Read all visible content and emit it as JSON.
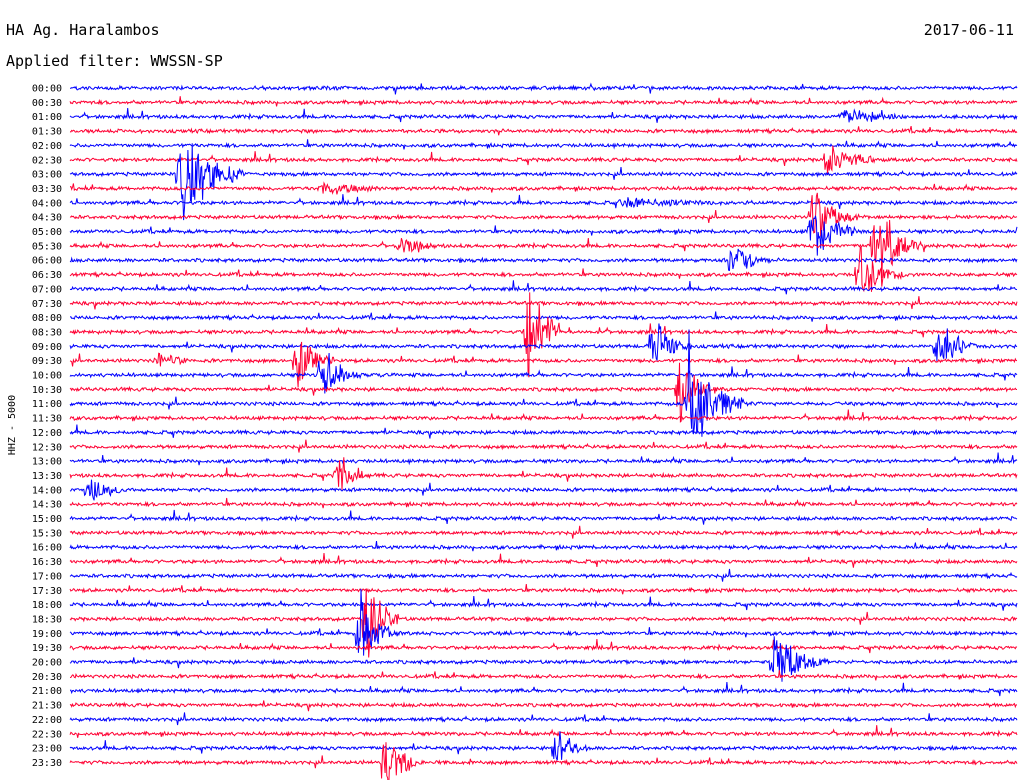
{
  "header": {
    "station": "HA Ag. Haralambos",
    "filter": "Applied filter: WWSSN-SP",
    "date": "2017-06-11"
  },
  "chart_data": {
    "type": "line",
    "title": "HA Ag. Haralambos",
    "ylabel": "HHZ - 5000",
    "row_interval_minutes": 30,
    "colors": {
      "blue": "#0000ff",
      "red": "#ff0033"
    },
    "rows": [
      "00:00",
      "00:30",
      "01:00",
      "01:30",
      "02:00",
      "02:30",
      "03:00",
      "03:30",
      "04:00",
      "04:30",
      "05:00",
      "05:30",
      "06:00",
      "06:30",
      "07:00",
      "07:30",
      "08:00",
      "08:30",
      "09:00",
      "09:30",
      "10:00",
      "10:30",
      "11:00",
      "11:30",
      "12:00",
      "12:30",
      "13:00",
      "13:30",
      "14:00",
      "14:30",
      "15:00",
      "15:30",
      "16:00",
      "16:30",
      "17:00",
      "17:30",
      "18:00",
      "18:30",
      "19:00",
      "19:30",
      "20:00",
      "20:30",
      "21:00",
      "21:30",
      "22:00",
      "22:30",
      "23:00",
      "23:30"
    ],
    "events": [
      {
        "row": 6,
        "minute": 3.5,
        "amplitude": 80,
        "duration_min": 2
      },
      {
        "row": 2,
        "minute": 24.5,
        "amplitude": 12,
        "duration_min": 2
      },
      {
        "row": 5,
        "minute": 24,
        "amplitude": 30,
        "duration_min": 1.5
      },
      {
        "row": 7,
        "minute": 8,
        "amplitude": 10,
        "duration_min": 2
      },
      {
        "row": 8,
        "minute": 17.5,
        "amplitude": 8,
        "duration_min": 3
      },
      {
        "row": 9,
        "minute": 23.5,
        "amplitude": 40,
        "duration_min": 1.5
      },
      {
        "row": 10,
        "minute": 23.5,
        "amplitude": 40,
        "duration_min": 1.5
      },
      {
        "row": 11,
        "minute": 25.5,
        "amplitude": 60,
        "duration_min": 1.5
      },
      {
        "row": 12,
        "minute": 21,
        "amplitude": 30,
        "duration_min": 1.2
      },
      {
        "row": 13,
        "minute": 25,
        "amplitude": 35,
        "duration_min": 1.5
      },
      {
        "row": 11,
        "minute": 10.5,
        "amplitude": 15,
        "duration_min": 1.2
      },
      {
        "row": 18,
        "minute": 18.5,
        "amplitude": 40,
        "duration_min": 1.2
      },
      {
        "row": 19,
        "minute": 7.2,
        "amplitude": 35,
        "duration_min": 1.2
      },
      {
        "row": 20,
        "minute": 8,
        "amplitude": 40,
        "duration_min": 1.2
      },
      {
        "row": 17,
        "minute": 14.5,
        "amplitude": 110,
        "duration_min": 1
      },
      {
        "row": 21,
        "minute": 19.3,
        "amplitude": 50,
        "duration_min": 1.2
      },
      {
        "row": 22,
        "minute": 19.6,
        "amplitude": 100,
        "duration_min": 1.8
      },
      {
        "row": 18,
        "minute": 27.5,
        "amplitude": 40,
        "duration_min": 1.2
      },
      {
        "row": 19,
        "minute": 2.8,
        "amplitude": 15,
        "duration_min": 1
      },
      {
        "row": 27,
        "minute": 8.5,
        "amplitude": 30,
        "duration_min": 1
      },
      {
        "row": 28,
        "minute": 0.6,
        "amplitude": 20,
        "duration_min": 1.2
      },
      {
        "row": 37,
        "minute": 9.4,
        "amplitude": 80,
        "duration_min": 1
      },
      {
        "row": 38,
        "minute": 9.2,
        "amplitude": 50,
        "duration_min": 1.2
      },
      {
        "row": 40,
        "minute": 22.3,
        "amplitude": 40,
        "duration_min": 1.8
      },
      {
        "row": 46,
        "minute": 15.4,
        "amplitude": 30,
        "duration_min": 1
      },
      {
        "row": 47,
        "minute": 10,
        "amplitude": 60,
        "duration_min": 1
      }
    ]
  }
}
